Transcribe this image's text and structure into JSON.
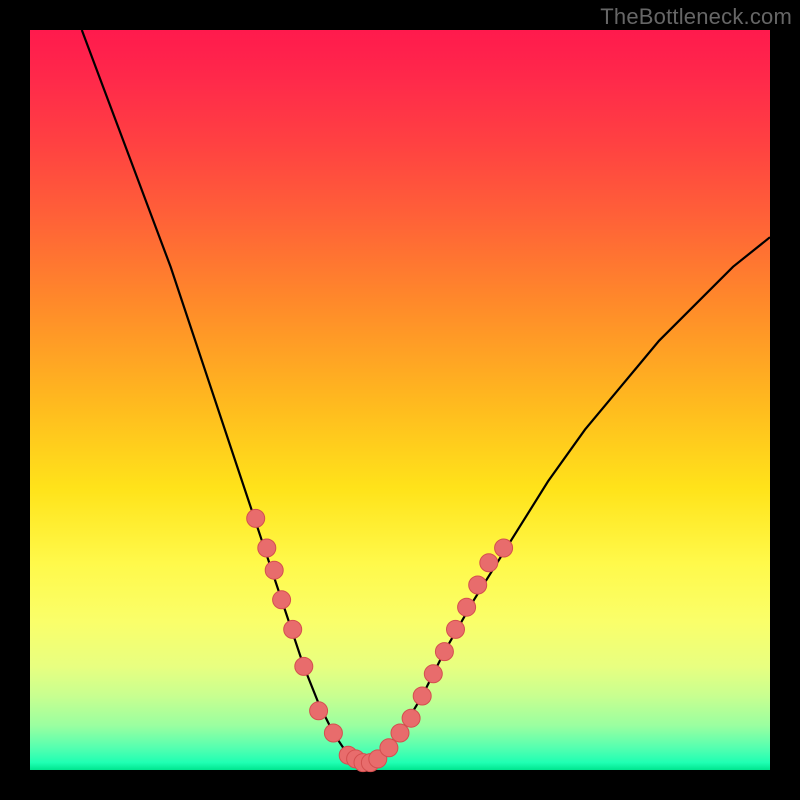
{
  "watermark": "TheBottleneck.com",
  "chart_data": {
    "type": "line",
    "title": "",
    "xlabel": "",
    "ylabel": "",
    "xlim": [
      0,
      100
    ],
    "ylim": [
      0,
      100
    ],
    "curve": {
      "name": "bottleneck-curve",
      "x": [
        7,
        10,
        13,
        16,
        19,
        22,
        25,
        28,
        31,
        33,
        35,
        37,
        39,
        41,
        43,
        45,
        47,
        50,
        53,
        56,
        60,
        65,
        70,
        75,
        80,
        85,
        90,
        95,
        100
      ],
      "y": [
        100,
        92,
        84,
        76,
        68,
        59,
        50,
        41,
        32,
        26,
        20,
        14,
        9,
        5,
        2,
        1,
        2,
        5,
        10,
        16,
        23,
        31,
        39,
        46,
        52,
        58,
        63,
        68,
        72
      ]
    },
    "series": [
      {
        "name": "left-cluster",
        "x": [
          30.5,
          32,
          33,
          34,
          35.5,
          37,
          39,
          41
        ],
        "y": [
          34,
          30,
          27,
          23,
          19,
          14,
          8,
          5
        ]
      },
      {
        "name": "bottom-cluster",
        "x": [
          43,
          44,
          45,
          46,
          47,
          48.5,
          50,
          51.5
        ],
        "y": [
          2,
          1.5,
          1,
          1,
          1.5,
          3,
          5,
          7
        ]
      },
      {
        "name": "right-cluster",
        "x": [
          53,
          54.5,
          56,
          57.5,
          59,
          60.5,
          62,
          64
        ],
        "y": [
          10,
          13,
          16,
          19,
          22,
          25,
          28,
          30
        ]
      }
    ],
    "gradient_direction": "vertical",
    "gradient_stops": [
      {
        "pos": 0,
        "color": "#ff1a4d"
      },
      {
        "pos": 50,
        "color": "#ffe31a"
      },
      {
        "pos": 100,
        "color": "#00e58f"
      }
    ]
  }
}
